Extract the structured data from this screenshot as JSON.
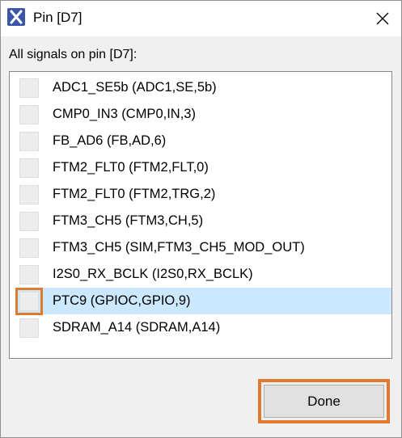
{
  "window": {
    "title": "Pin [D7]"
  },
  "section_label": "All signals on pin [D7]:",
  "signals": [
    {
      "label": "ADC1_SE5b (ADC1,SE,5b)",
      "checked": false,
      "selected": false
    },
    {
      "label": "CMP0_IN3 (CMP0,IN,3)",
      "checked": false,
      "selected": false
    },
    {
      "label": "FB_AD6 (FB,AD,6)",
      "checked": false,
      "selected": false
    },
    {
      "label": "FTM2_FLT0 (FTM2,FLT,0)",
      "checked": false,
      "selected": false
    },
    {
      "label": "FTM2_FLT0 (FTM2,TRG,2)",
      "checked": false,
      "selected": false
    },
    {
      "label": "FTM3_CH5 (FTM3,CH,5)",
      "checked": false,
      "selected": false
    },
    {
      "label": "FTM3_CH5 (SIM,FTM3_CH5_MOD_OUT)",
      "checked": false,
      "selected": false
    },
    {
      "label": "I2S0_RX_BCLK (I2S0,RX_BCLK)",
      "checked": false,
      "selected": false
    },
    {
      "label": "PTC9 (GPIOC,GPIO,9)",
      "checked": false,
      "selected": true
    },
    {
      "label": "SDRAM_A14 (SDRAM,A14)",
      "checked": false,
      "selected": false
    }
  ],
  "buttons": {
    "done_label": "Done"
  },
  "colors": {
    "highlight": "#e07a2e",
    "selection": "#cce8ff",
    "app_icon": "#3b55a8"
  }
}
